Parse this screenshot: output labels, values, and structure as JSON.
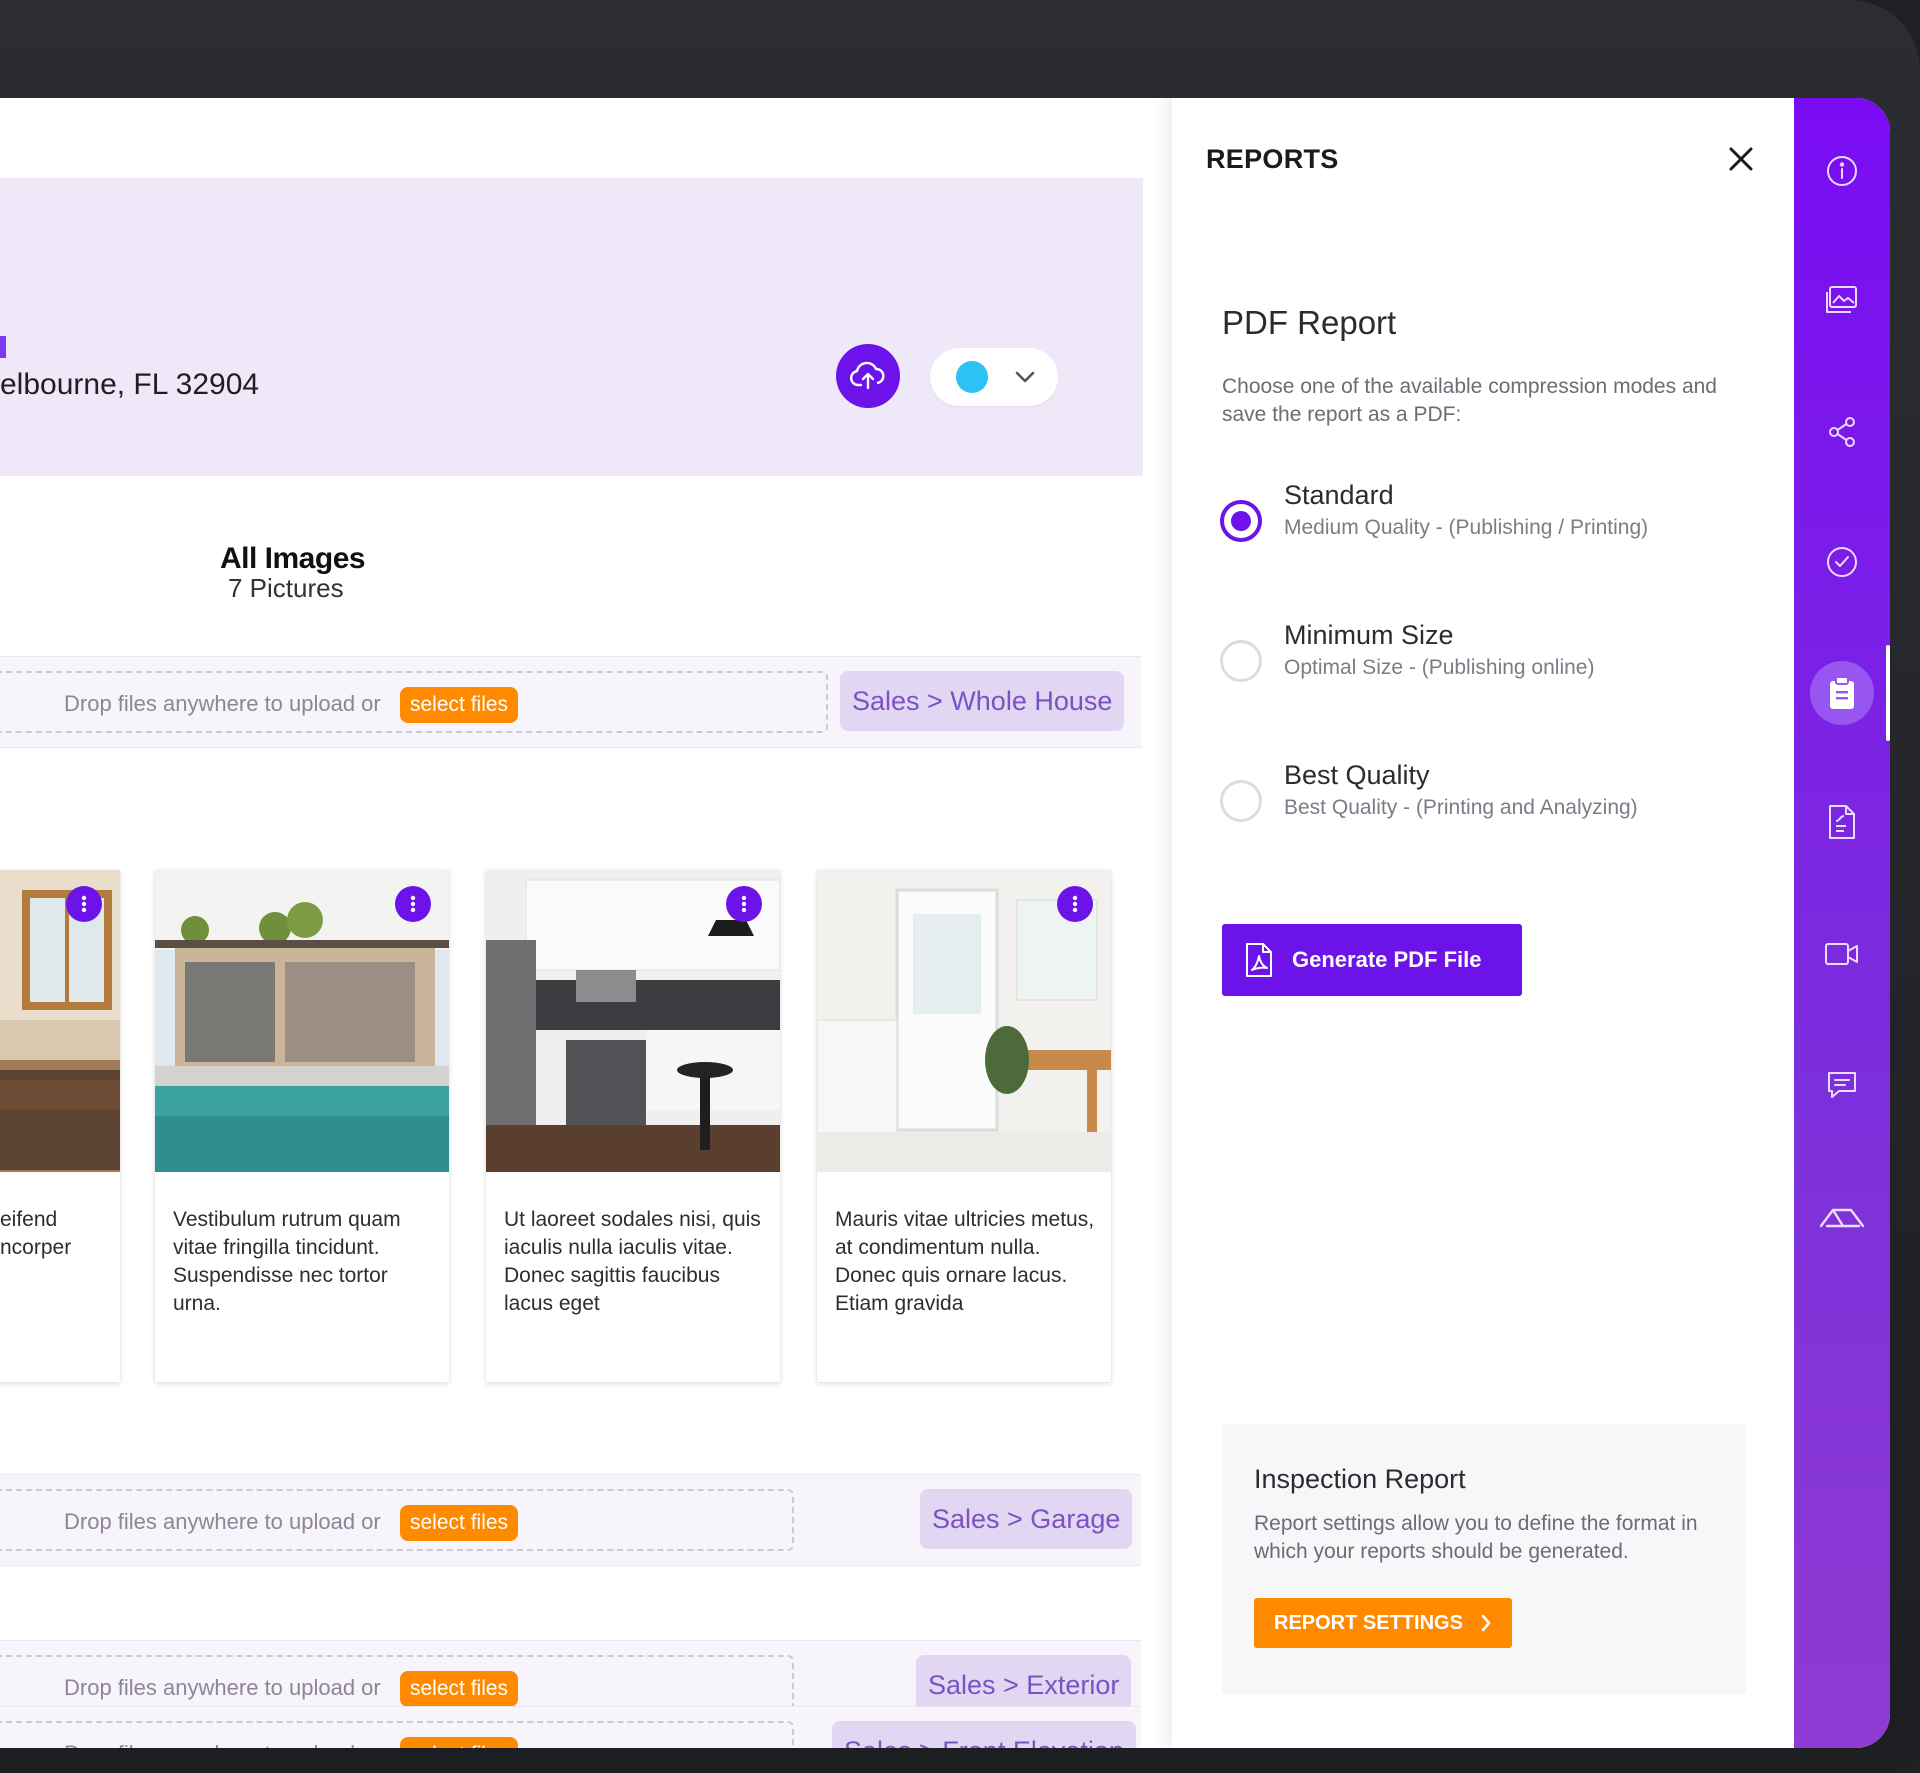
{
  "header": {
    "address": "elbourne, FL 32904",
    "status_color": "#2ec1f5"
  },
  "gallery": {
    "title": "All Images",
    "count": "7 Pictures",
    "drop_text": "Drop files anywhere to upload or",
    "select_files": "select files",
    "sections": [
      {
        "category": "Sales > Whole House"
      },
      {
        "category": "Sales > Garage"
      },
      {
        "category": "Sales > Exterior"
      },
      {
        "category": "Sales > Front Elevation"
      }
    ],
    "cards": [
      {
        "text": "eifend\nncorper",
        "image": "living-room"
      },
      {
        "text": "Vestibulum rutrum quam vitae fringilla tincidunt. Suspendisse nec tortor urna.",
        "image": "pool-house"
      },
      {
        "text": "Ut laoreet sodales nisi, quis iaculis nulla iaculis vitae. Donec sagittis faucibus lacus eget",
        "image": "kitchen"
      },
      {
        "text": "Mauris vitae ultricies metus, at condimentum nulla. Donec quis ornare lacus. Etiam gravida",
        "image": "white-kitchen-door"
      }
    ]
  },
  "panel": {
    "title": "REPORTS",
    "pdf_title": "PDF Report",
    "pdf_desc": "Choose one of the available compression modes and save the report as a PDF:",
    "options": [
      {
        "label": "Standard",
        "sub": "Medium Quality - (Publishing / Printing)",
        "checked": true
      },
      {
        "label": "Minimum Size",
        "sub": "Optimal Size - (Publishing online)",
        "checked": false
      },
      {
        "label": "Best Quality",
        "sub": "Best Quality - (Printing and Analyzing)",
        "checked": false
      }
    ],
    "generate_label": "Generate PDF File",
    "inspection": {
      "title": "Inspection Report",
      "desc": "Report settings allow you to define the format in which your reports should be generated.",
      "button": "REPORT SETTINGS"
    }
  },
  "rail": {
    "items": [
      "info-icon",
      "images-icon",
      "share-icon",
      "check-circle-icon",
      "clipboard-icon",
      "document-icon",
      "video-icon",
      "chat-icon",
      "roof-icon"
    ],
    "active": "clipboard-icon"
  },
  "colors": {
    "accent": "#6b13e8",
    "orange": "#ff8a00",
    "header_bg": "#efe8f9"
  }
}
